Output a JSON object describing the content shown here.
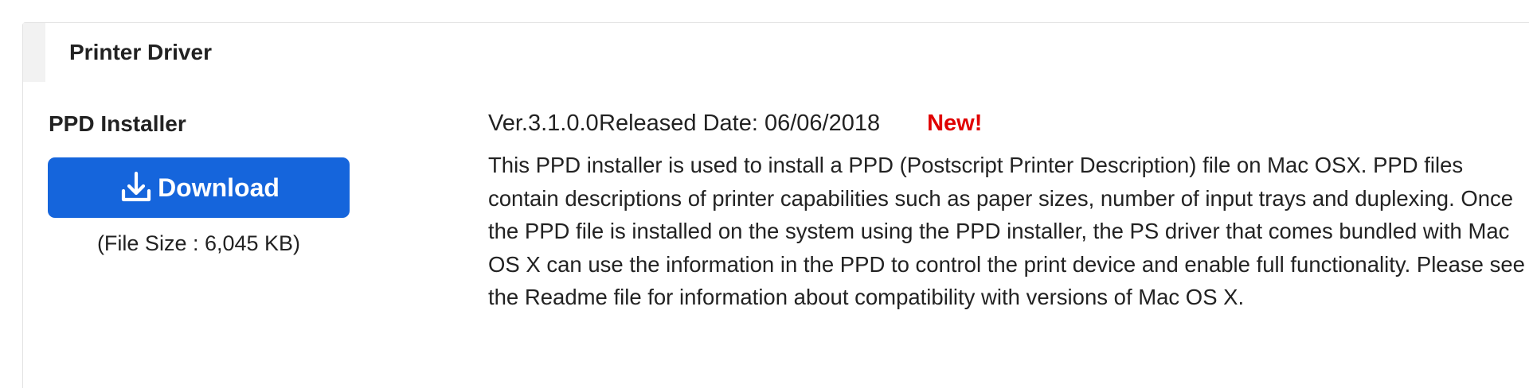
{
  "panel": {
    "title": "Printer Driver"
  },
  "product": {
    "name": "PPD Installer",
    "download_label": "Download",
    "download_icon": "download-icon",
    "file_size": "(File Size : 6,045 KB)",
    "version": "Ver.3.1.0.0",
    "released": "Released Date: 06/06/2018",
    "new_badge": "New!",
    "description": "This PPD installer is used to install a PPD (Postscript Printer Description) file on Mac OSX. PPD files contain descriptions of printer capabilities such as paper sizes, number of input trays and duplexing. Once the PPD file is installed on the system using the PPD installer, the PS driver that comes bundled with Mac OS X can use the information in the PPD to control the print device and enable full functionality. Please see the Readme file for information about compatibility with versions of Mac OS X."
  },
  "colors": {
    "button": "#1565dc",
    "new_badge": "#e00000",
    "header_bg": "#f2f2f2",
    "text": "#222222"
  }
}
